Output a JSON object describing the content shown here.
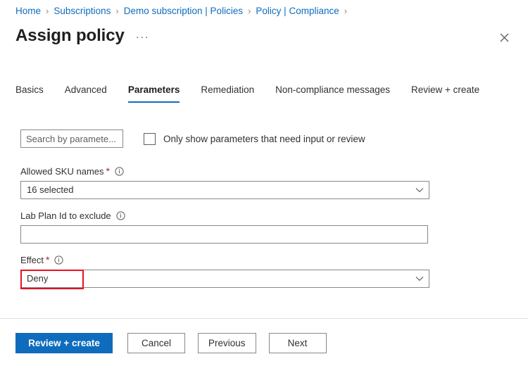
{
  "breadcrumb": {
    "separator": "›",
    "items": [
      {
        "label": "Home"
      },
      {
        "label": "Subscriptions"
      },
      {
        "label": "Demo subscription | Policies"
      },
      {
        "label": "Policy | Compliance"
      }
    ]
  },
  "header": {
    "title": "Assign policy",
    "more_menu": "···",
    "close_icon": "close-icon"
  },
  "tabs": [
    {
      "label": "Basics",
      "active": false
    },
    {
      "label": "Advanced",
      "active": false
    },
    {
      "label": "Parameters",
      "active": true
    },
    {
      "label": "Remediation",
      "active": false
    },
    {
      "label": "Non-compliance messages",
      "active": false
    },
    {
      "label": "Review + create",
      "active": false
    }
  ],
  "filter": {
    "search_placeholder": "Search by paramete...",
    "search_value": "",
    "checkbox_label": "Only show parameters that need input or review",
    "checkbox_checked": false
  },
  "parameters": [
    {
      "label": "Allowed SKU names",
      "required": true,
      "required_marker": "*",
      "info_icon": "info-icon",
      "type": "dropdown",
      "value": "16 selected",
      "highlighted": false
    },
    {
      "label": "Lab Plan Id to exclude",
      "required": false,
      "required_marker": "",
      "info_icon": "info-icon",
      "type": "textbox",
      "value": "",
      "highlighted": false
    },
    {
      "label": "Effect",
      "required": true,
      "required_marker": "*",
      "info_icon": "info-icon",
      "type": "dropdown",
      "value": "Deny",
      "highlighted": true
    }
  ],
  "footer": {
    "primary": "Review + create",
    "cancel": "Cancel",
    "previous": "Previous",
    "next": "Next"
  },
  "colors": {
    "accent": "#0f6cbd",
    "required": "#a4262c",
    "annotation": "#e81123",
    "border": "#8a8886",
    "divider": "#e1dfdd"
  }
}
